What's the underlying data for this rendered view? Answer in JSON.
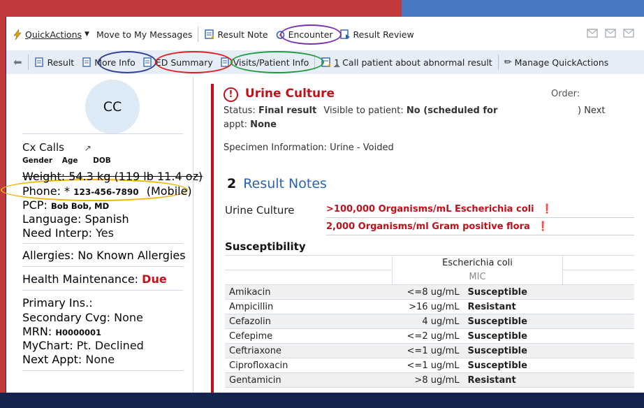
{
  "toolbar1": {
    "quickactions": "QuickActions",
    "move_msgs": "Move to My Messages",
    "result_note": "Result Note",
    "encounter": "Encounter",
    "result_review": "Result Review"
  },
  "toolbar2": {
    "result": "Result",
    "more_info": "More Info",
    "ed_summary": "ED Summary",
    "visits": "Visits/Patient Info",
    "call_count": "1",
    "call_text": " Call patient about abnormal result",
    "manage": "Manage QuickActions"
  },
  "patient": {
    "avatar": "CC",
    "name": "Cx Calls",
    "gender_label": "Gender",
    "age_label": "Age",
    "dob_label": "DOB",
    "weight": "Weight: 54.3 kg (119 lb 11.4 oz)",
    "phone_label": "Phone: *",
    "phone": "123-456-7890",
    "phone_type": "(Mobile)",
    "pcp_label": "PCP:",
    "pcp": "Bob Bob, MD",
    "language": "Language: Spanish",
    "interp_label": "Need Interp:",
    "interp": "Yes",
    "allergies": "Allergies: No Known Allergies",
    "hm_label": "Health Maintenance:",
    "hm": "Due",
    "primary": "Primary Ins.:",
    "secondary_label": "Secondary Cvg:",
    "secondary": "None",
    "mrn_label": "MRN:",
    "mrn": "H0000001",
    "mychart_label": "MyChart:",
    "mychart": "Pt. Declined",
    "next_appt_label": "Next Appt:",
    "next_appt": "None"
  },
  "result": {
    "title": "Urine Culture",
    "order_label": "Order:",
    "status_label": "Status:",
    "status": "Final result",
    "visible_label": "Visible to patient:",
    "visible": "No (scheduled for",
    "next_label": ") Next",
    "appt_label": "appt:",
    "appt": "None",
    "specimen_label": "Specimen Information:",
    "specimen": "Urine - Voided",
    "notes_count": "2",
    "notes_label": "Result Notes",
    "culture_label": "Urine Culture",
    "culture1": ">100,000 Organisms/mL Escherichia coli",
    "culture2": "2,000 Organisms/ml Gram positive flora",
    "susceptibility": "Susceptibility",
    "organism": "Escherichia coli",
    "mic": "MIC",
    "rows": [
      {
        "drug": "Amikacin",
        "value": "<=8 ug/mL",
        "interp": "Susceptible"
      },
      {
        "drug": "Ampicillin",
        "value": ">16 ug/mL",
        "interp": "Resistant"
      },
      {
        "drug": "Cefazolin",
        "value": "4 ug/mL",
        "interp": "Susceptible"
      },
      {
        "drug": "Cefepime",
        "value": "<=2 ug/mL",
        "interp": "Susceptible"
      },
      {
        "drug": "Ceftriaxone",
        "value": "<=1 ug/mL",
        "interp": "Susceptible"
      },
      {
        "drug": "Ciprofloxacin",
        "value": "<=1 ug/mL",
        "interp": "Susceptible"
      },
      {
        "drug": "Gentamicin",
        "value": ">8 ug/mL",
        "interp": "Resistant"
      }
    ]
  },
  "colors": {
    "annot_blue": "#2f3f9c",
    "annot_red": "#e02020",
    "annot_green": "#1e9e3e",
    "annot_purple": "#7b2fb5",
    "annot_yellow": "#f0b400",
    "alert_red": "#c0101a",
    "link_blue": "#2a62b8"
  }
}
